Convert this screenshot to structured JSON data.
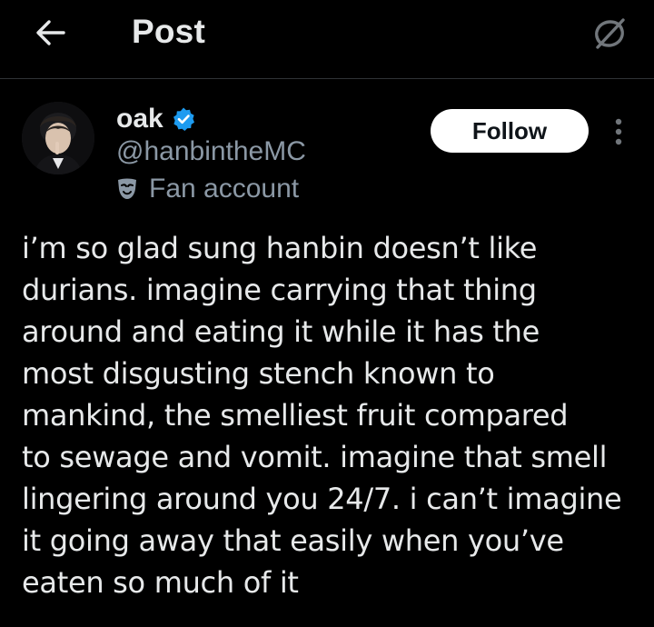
{
  "header": {
    "title": "Post",
    "back_icon": "arrow-left-icon",
    "grok_icon": "grok-icon"
  },
  "author": {
    "display_name": "oak",
    "handle": "@hanbintheMC",
    "label": "Fan account",
    "label_icon": "mask-icon",
    "verified_icon": "verified-badge-icon",
    "verified_color": "#1d9bf0"
  },
  "actions": {
    "follow_label": "Follow",
    "more_icon": "more-vertical-icon"
  },
  "tweet": {
    "text": "i’m so glad sung hanbin doesn’t like\ndurians. imagine carrying that thing\naround and eating it while it has the\nmost disgusting stench known to\nmankind, the smelliest fruit compared\nto sewage and vomit. imagine that smell\nlingering around you 24/7. i can’t imagine\nit going away that easily when you’ve\neaten so much of it"
  },
  "colors": {
    "background": "#000000",
    "text_primary": "#e7e9ea",
    "text_secondary": "#8b98a5",
    "divider": "#2f3336",
    "button_bg": "#ffffff",
    "button_text": "#0f1419"
  }
}
